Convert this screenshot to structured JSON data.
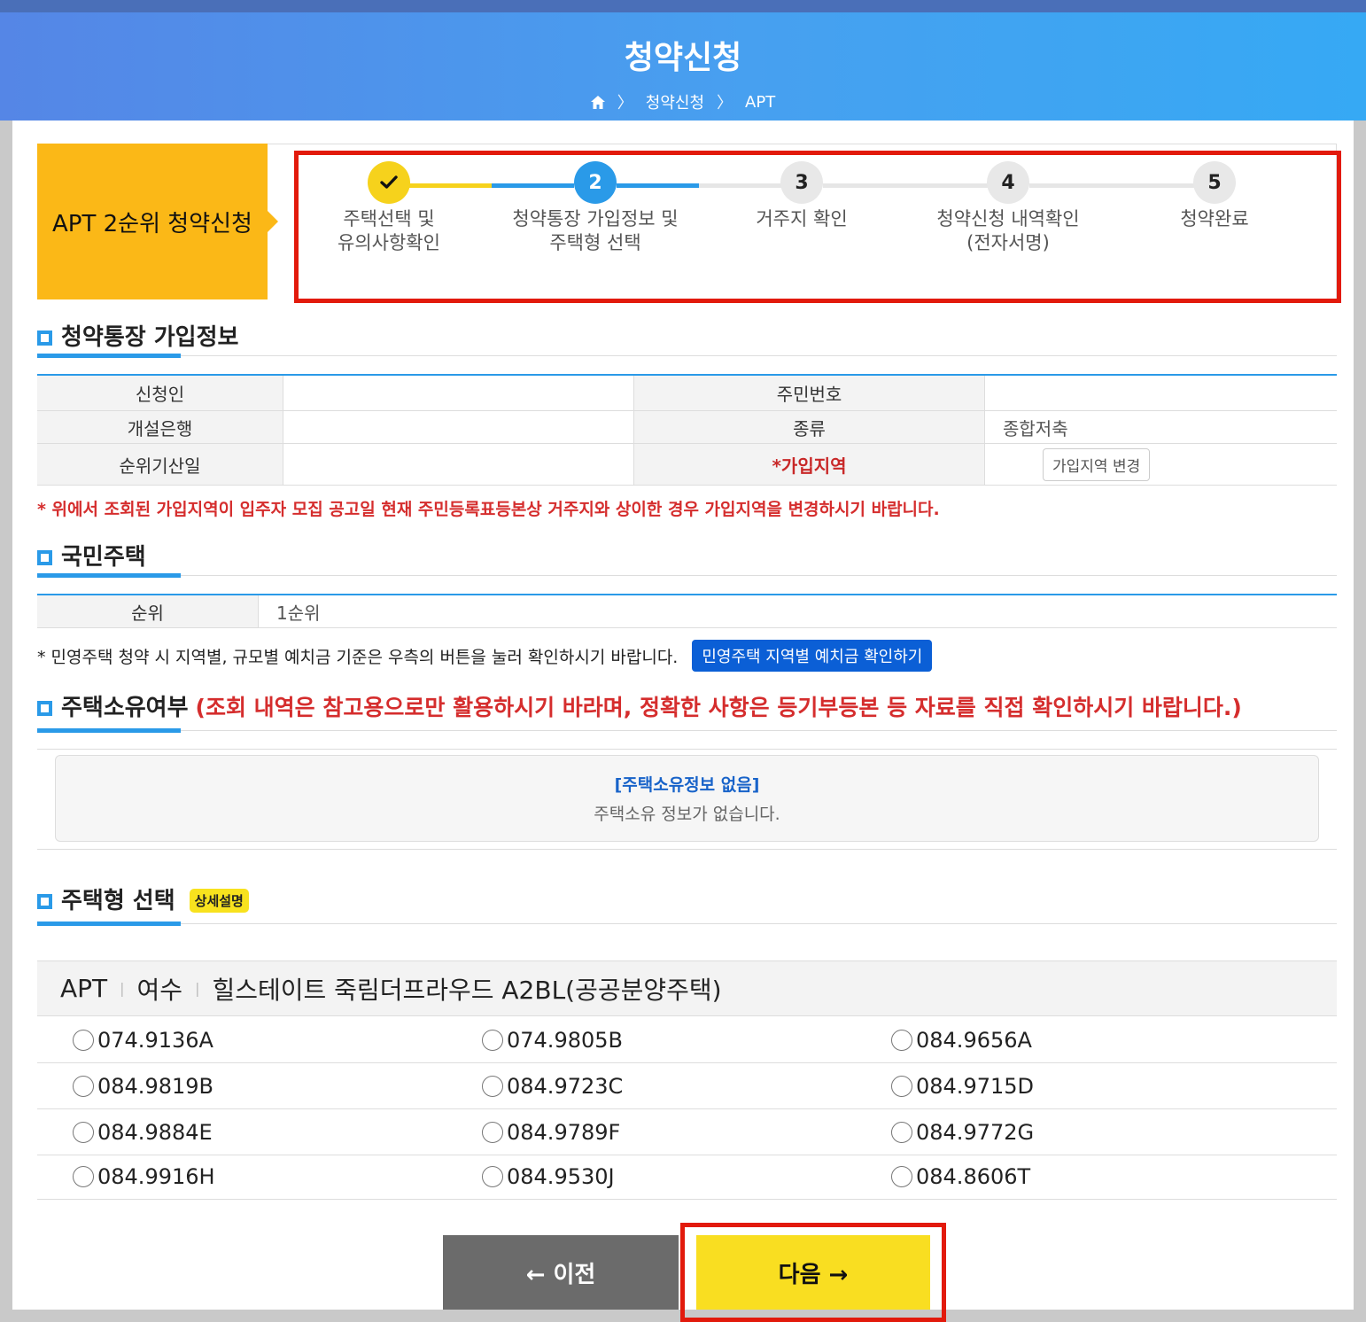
{
  "header": {
    "title": "청약신청",
    "breadcrumb": [
      "청약신청",
      "APT"
    ]
  },
  "steps": {
    "label": "APT 2순위 청약신청",
    "items": [
      {
        "number": "",
        "lines": [
          "주택선택 및",
          "유의사항확인"
        ],
        "state": "done"
      },
      {
        "number": "2",
        "lines": [
          "청약통장 가입정보 및",
          "주택형 선택"
        ],
        "state": "current"
      },
      {
        "number": "3",
        "lines": [
          "거주지 확인",
          ""
        ],
        "state": "todo"
      },
      {
        "number": "4",
        "lines": [
          "청약신청 내역확인",
          "(전자서명)"
        ],
        "state": "todo"
      },
      {
        "number": "5",
        "lines": [
          "청약완료",
          ""
        ],
        "state": "todo"
      }
    ]
  },
  "account_info": {
    "title": "청약통장 가입정보",
    "rows": [
      {
        "label1": "신청인",
        "value1": "",
        "label2": "주민번호",
        "value2": ""
      },
      {
        "label1": "개설은행",
        "value1": "",
        "label2": "종류",
        "value2": "종합저축"
      },
      {
        "label1": "순위기산일",
        "value1": "",
        "label2": "*가입지역",
        "value2": ""
      }
    ],
    "change_region_button": "가입지역 변경",
    "warning": "* 위에서 조회된 가입지역이 입주자 모집 공고일 현재 주민등록표등본상 거주지와 상이한 경우 가입지역을 변경하시기 바랍니다."
  },
  "national_housing": {
    "title": "국민주택",
    "rank_label": "순위",
    "rank_value": "1순위",
    "note": "* 민영주택 청약 시 지역별, 규모별 예치금 기준은 우측의 버튼을 눌러 확인하시기 바랍니다.",
    "deposit_button": "민영주택 지역별 예치금 확인하기"
  },
  "ownership": {
    "title": "주택소유여부",
    "note": "(조회 내역은 참고용으로만 활용하시기 바라며, 정확한 사항은 등기부등본 등 자료를 직접 확인하시기 바랍니다.)",
    "box_head": "[주택소유정보 없음]",
    "box_message": "주택소유 정보가 없습니다."
  },
  "house_type": {
    "title": "주택형 선택",
    "badge": "상세설명",
    "apt_type": "APT",
    "region": "여수",
    "complex": "힐스테이트 죽림더프라우드 A2BL(공공분양주택)",
    "options": [
      [
        "074.9136A",
        "074.9805B",
        "084.9656A"
      ],
      [
        "084.9819B",
        "084.9723C",
        "084.9715D"
      ],
      [
        "084.9884E",
        "084.9789F",
        "084.9772G"
      ],
      [
        "084.9916H",
        "084.9530J",
        "084.8606T"
      ]
    ]
  },
  "nav": {
    "prev": "← 이전",
    "next": "다음 →"
  },
  "colors": {
    "header_blue": "#47a0f0",
    "step_yellow": "#fbb817",
    "accent_blue": "#2a9ae8",
    "highlight_red": "#e21a0c",
    "next_yellow": "#f9de21"
  }
}
